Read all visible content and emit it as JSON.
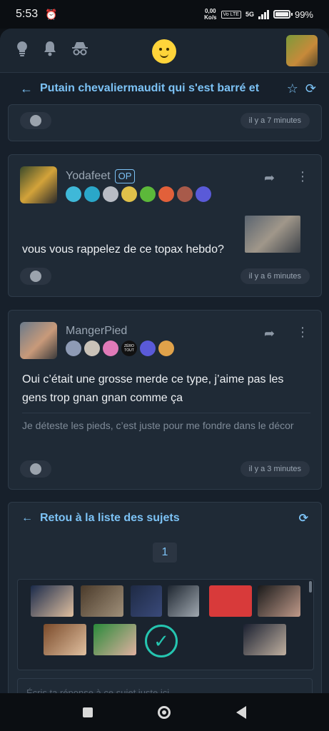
{
  "status": {
    "time": "5:53",
    "net_speed": "0,00",
    "net_unit": "Ko/s",
    "net_tag": "Vo LTE",
    "net_type": "5G",
    "battery": "99%"
  },
  "topbar": {
    "icons": [
      "lightbulb-icon",
      "bell-icon",
      "incognito-icon"
    ]
  },
  "thread": {
    "title": "Putain chevaliermaudit qui s'est barré et"
  },
  "posts": [
    {
      "time": "il y a 7 minutes"
    },
    {
      "username": "Yodafeet",
      "op": "OP",
      "text": "vous vous rappelez de ce topax hebdo?",
      "time": "il y a 6 minutes"
    },
    {
      "username": "MangerPied",
      "text": "Oui c’était une grosse merde ce type, j’aime pas les gens trop gnan gnan comme ça",
      "signature": "Je déteste les pieds, c’est juste pour me fondre dans le décor",
      "time": "il y a 3 minutes"
    }
  ],
  "badge_zero_tout": "ZÉRO TOUT",
  "list": {
    "back_label": "Retou à la liste des sujets",
    "page": "1"
  },
  "reply": {
    "placeholder": "Écris ta réponse à ce sujet juste ici..."
  },
  "colors": {
    "accent": "#7cc2f5",
    "bg": "#17202b",
    "card": "#1f2a36",
    "check": "#25c5b0"
  }
}
